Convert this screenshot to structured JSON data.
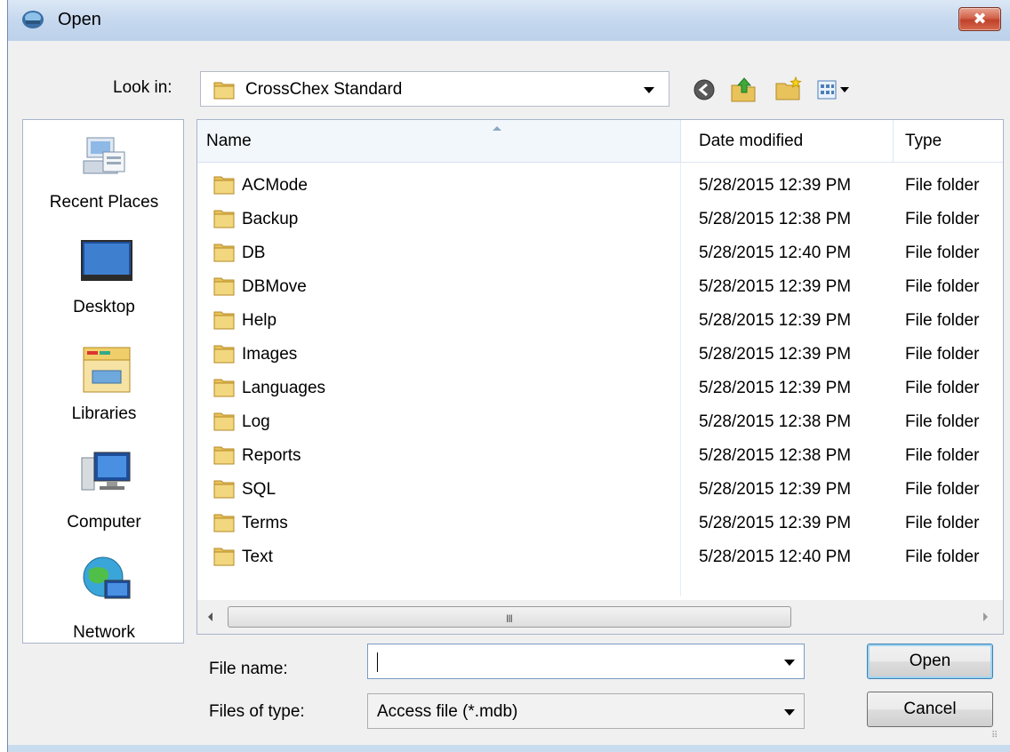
{
  "window": {
    "title": "Open",
    "close_glyph": "✖"
  },
  "lookin": {
    "label": "Look in:",
    "value": "CrossChex Standard"
  },
  "toolbar": {
    "icons": [
      "back-icon",
      "up-folder-icon",
      "new-folder-icon",
      "view-menu-icon"
    ]
  },
  "places": [
    {
      "label": "Recent Places",
      "icon": "recent-places-icon"
    },
    {
      "label": "Desktop",
      "icon": "desktop-icon"
    },
    {
      "label": "Libraries",
      "icon": "libraries-icon"
    },
    {
      "label": "Computer",
      "icon": "computer-icon"
    },
    {
      "label": "Network",
      "icon": "network-icon"
    }
  ],
  "list": {
    "columns": [
      "Name",
      "Date modified",
      "Type"
    ],
    "rows": [
      {
        "name": "ACMode",
        "date": "5/28/2015 12:39 PM",
        "type": "File folder"
      },
      {
        "name": "Backup",
        "date": "5/28/2015 12:38 PM",
        "type": "File folder"
      },
      {
        "name": "DB",
        "date": "5/28/2015 12:40 PM",
        "type": "File folder"
      },
      {
        "name": "DBMove",
        "date": "5/28/2015 12:39 PM",
        "type": "File folder"
      },
      {
        "name": "Help",
        "date": "5/28/2015 12:39 PM",
        "type": "File folder"
      },
      {
        "name": "Images",
        "date": "5/28/2015 12:39 PM",
        "type": "File folder"
      },
      {
        "name": "Languages",
        "date": "5/28/2015 12:39 PM",
        "type": "File folder"
      },
      {
        "name": "Log",
        "date": "5/28/2015 12:38 PM",
        "type": "File folder"
      },
      {
        "name": "Reports",
        "date": "5/28/2015 12:38 PM",
        "type": "File folder"
      },
      {
        "name": "SQL",
        "date": "5/28/2015 12:39 PM",
        "type": "File folder"
      },
      {
        "name": "Terms",
        "date": "5/28/2015 12:39 PM",
        "type": "File folder"
      },
      {
        "name": "Text",
        "date": "5/28/2015 12:40 PM",
        "type": "File folder"
      }
    ],
    "scroll_grip": "III"
  },
  "filename": {
    "label": "File name:",
    "value": ""
  },
  "filetype": {
    "label": "Files of type:",
    "value": "Access file (*.mdb)"
  },
  "buttons": {
    "open": "Open",
    "cancel": "Cancel"
  },
  "colors": {
    "titlebar": "#c4d7ee",
    "close": "#c0412b",
    "folder": "#e8c25a"
  }
}
